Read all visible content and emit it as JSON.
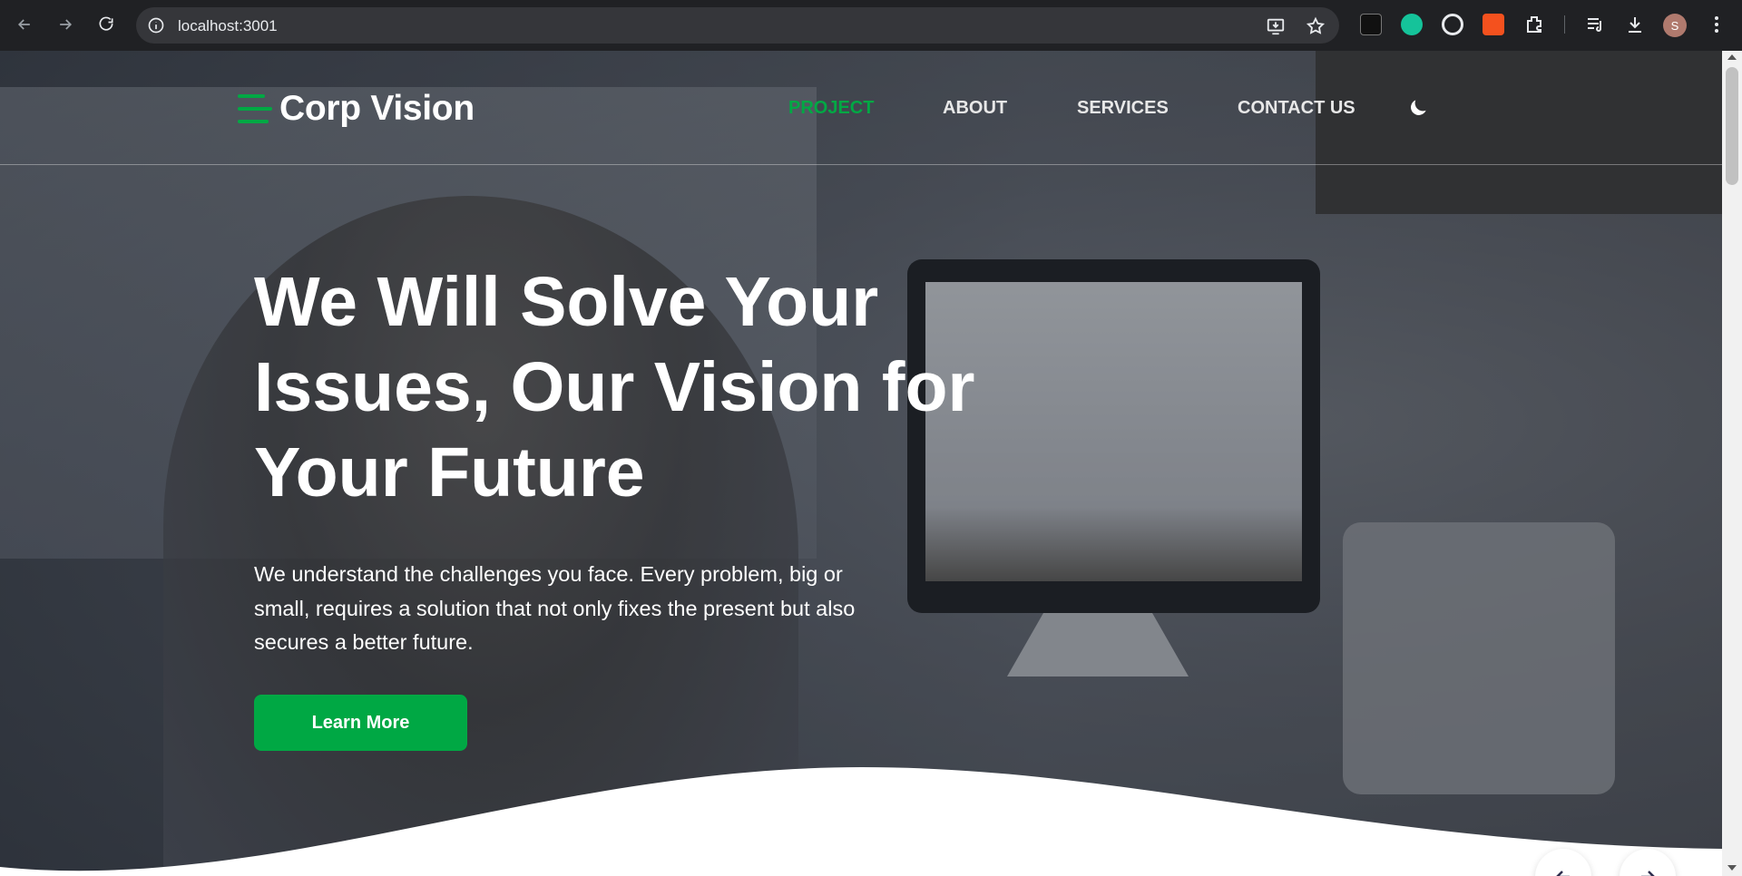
{
  "browser": {
    "url": "localhost:3001",
    "profile_initial": "S",
    "icons": [
      "back-arrow-icon",
      "forward-arrow-icon",
      "reload-icon",
      "site-info-icon",
      "install-app-icon",
      "bookmark-star-icon",
      "extensions-icon",
      "media-icon",
      "downloads-icon",
      "more-menu-icon"
    ]
  },
  "site": {
    "brand": "Corp Vision",
    "nav": [
      {
        "label": "PROJECT",
        "active": true
      },
      {
        "label": "ABOUT",
        "active": false
      },
      {
        "label": "SERVICES",
        "active": false
      },
      {
        "label": "CONTACT US",
        "active": false
      }
    ],
    "theme_toggle_icon": "moon-icon"
  },
  "hero": {
    "headline_line1": "We Will Solve Your",
    "headline_line2": "Issues, Our Vision for",
    "headline_line3": "Your Future",
    "sub_line1": "We understand the challenges you face. Every problem, big or",
    "sub_line2": "small, requires a solution that not only fixes the present but also",
    "sub_line3": "secures a better future.",
    "cta_label": "Learn More"
  },
  "colors": {
    "accent": "#00a844",
    "chrome_bg": "#202124",
    "omnibox_bg": "#35363a",
    "text_light": "#ffffff"
  }
}
